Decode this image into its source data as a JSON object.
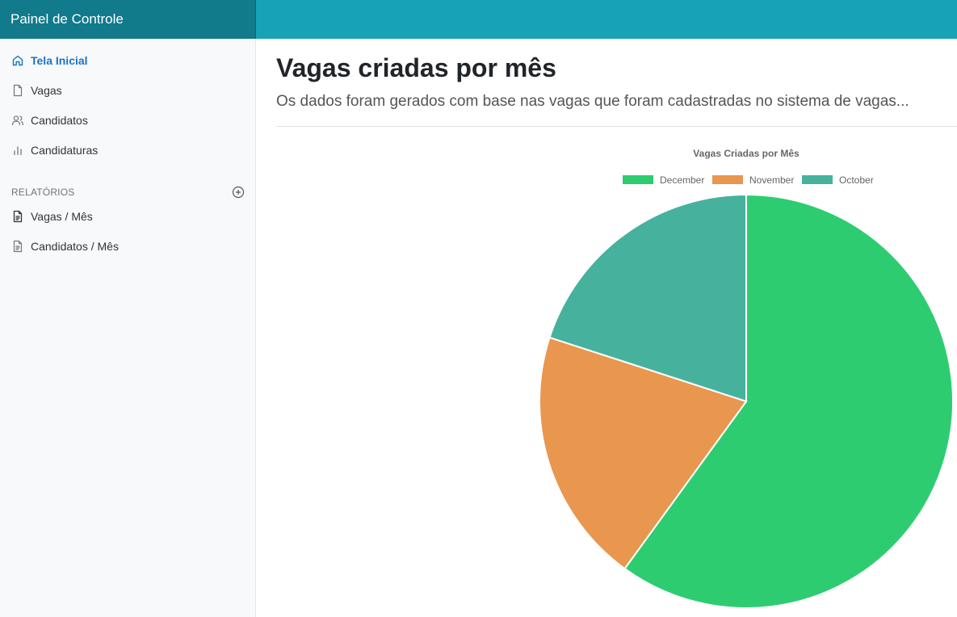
{
  "app": {
    "brand": "Painel de Controle"
  },
  "sidebar": {
    "items": [
      {
        "label": "Tela Inicial",
        "icon": "home-icon",
        "active": true
      },
      {
        "label": "Vagas",
        "icon": "file-icon"
      },
      {
        "label": "Candidatos",
        "icon": "users-icon"
      },
      {
        "label": "Candidaturas",
        "icon": "bar-chart-icon"
      }
    ],
    "reports_title": "RELATÓRIOS",
    "reports": [
      {
        "label": "Vagas / Mês",
        "icon": "file-text-icon"
      },
      {
        "label": "Candidatos / Mês",
        "icon": "file-text-icon"
      }
    ]
  },
  "main": {
    "title": "Vagas criadas por mês",
    "subtitle": "Os dados foram gerados com base nas vagas que foram cadastradas no sistema de vagas..."
  },
  "colors": {
    "topbar": "#17a2b8",
    "brand_bg": "#117a8b",
    "accent": "#1a73c8",
    "december": "#2ecc71",
    "november": "#e9964e",
    "october": "#46b29d"
  },
  "chart_data": {
    "type": "pie",
    "title": "Vagas Criadas por Mês",
    "legend_position": "top",
    "categories": [
      "December",
      "November",
      "October"
    ],
    "values": [
      60,
      20,
      20
    ],
    "colors": [
      "#2ecc71",
      "#e9964e",
      "#46b29d"
    ]
  }
}
